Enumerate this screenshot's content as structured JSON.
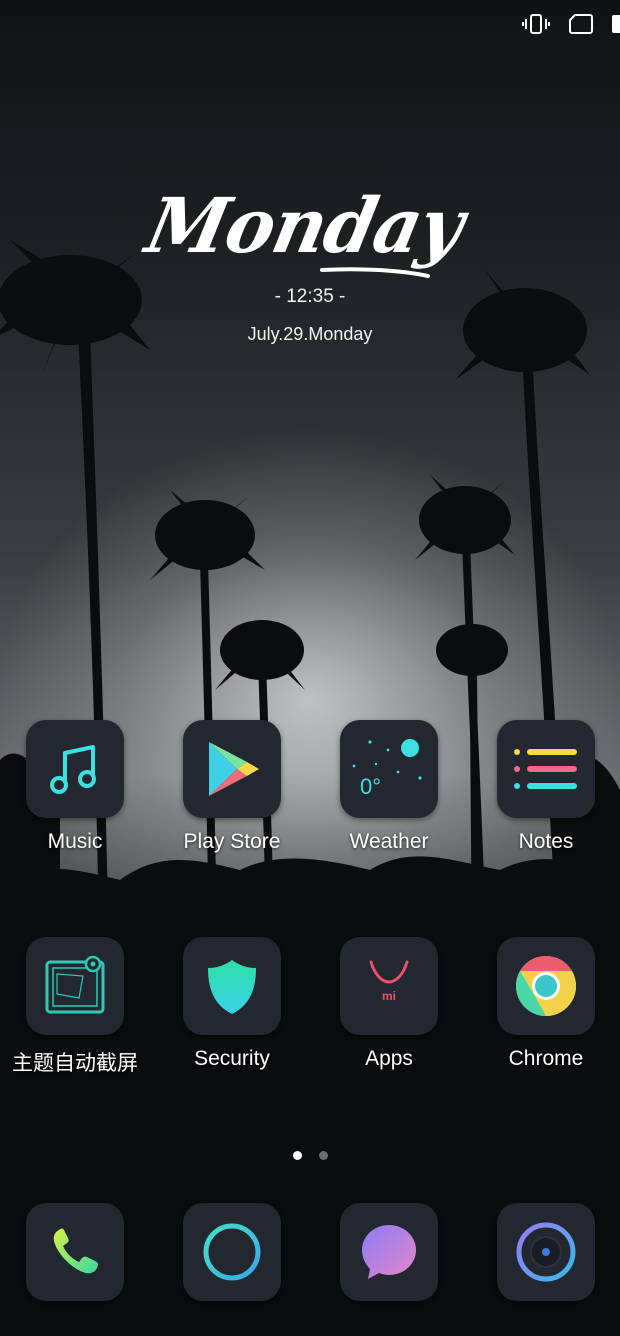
{
  "clock": {
    "day": "Monday",
    "time": "- 12:35 -",
    "date": "July.29.Monday"
  },
  "apps": [
    {
      "label": "Music",
      "icon": "music-note-icon"
    },
    {
      "label": "Play Store",
      "icon": "play-store-icon"
    },
    {
      "label": "Weather",
      "icon": "weather-icon"
    },
    {
      "label": "Notes",
      "icon": "notes-icon"
    },
    {
      "label": "主题自动截屏",
      "icon": "screenshot-icon"
    },
    {
      "label": "Security",
      "icon": "shield-icon"
    },
    {
      "label": "Apps",
      "icon": "mi-shopping-bag-icon"
    },
    {
      "label": "Chrome",
      "icon": "chrome-icon"
    }
  ],
  "weather_icon_text": "0°",
  "apps_icon_text": "mi",
  "dock": [
    {
      "name": "phone",
      "icon": "phone-icon"
    },
    {
      "name": "browser",
      "icon": "ring-icon"
    },
    {
      "name": "messages",
      "icon": "chat-bubble-icon"
    },
    {
      "name": "camera",
      "icon": "camera-lens-icon"
    }
  ],
  "page_indicator": {
    "pages": 2,
    "current": 1
  },
  "colors": {
    "icon_bg": "#232730",
    "accent_cyan": "#3de0e0",
    "accent_yellow": "#f6d84a",
    "accent_pink": "#ee6a8a"
  }
}
